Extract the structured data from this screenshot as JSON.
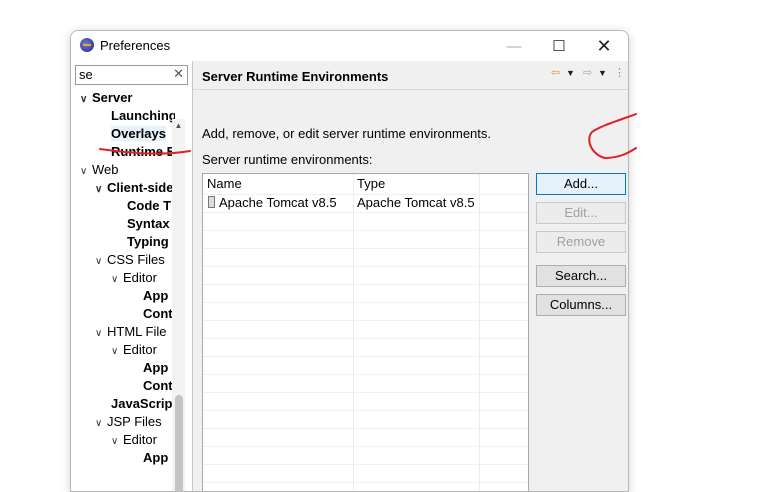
{
  "window": {
    "title": "Preferences",
    "minimize": "—",
    "maximize": "☐",
    "close": "✕"
  },
  "filter": {
    "value": "se",
    "clear": "✕"
  },
  "tree": [
    {
      "twisty": "∨",
      "label": "Server",
      "bold": true
    },
    {
      "twisty": "",
      "label": "Launching",
      "bold": true
    },
    {
      "twisty": "",
      "label": "Overlays",
      "bold": true,
      "selected": true
    },
    {
      "twisty": "",
      "label": "Runtime E",
      "bold": true
    },
    {
      "twisty": "∨",
      "label": "Web",
      "bold": false
    },
    {
      "twisty": "∨",
      "label": "Client-side",
      "bold": true
    },
    {
      "twisty": "",
      "label": "Code T",
      "bold": true
    },
    {
      "twisty": "",
      "label": "Syntax",
      "bold": true
    },
    {
      "twisty": "",
      "label": "Typing",
      "bold": true
    },
    {
      "twisty": "∨",
      "label": "CSS Files",
      "bold": false
    },
    {
      "twisty": "∨",
      "label": "Editor",
      "bold": false
    },
    {
      "twisty": "",
      "label": "App",
      "bold": true
    },
    {
      "twisty": "",
      "label": "Cont",
      "bold": true
    },
    {
      "twisty": "∨",
      "label": "HTML File",
      "bold": false
    },
    {
      "twisty": "∨",
      "label": "Editor",
      "bold": false
    },
    {
      "twisty": "",
      "label": "App",
      "bold": true
    },
    {
      "twisty": "",
      "label": "Cont",
      "bold": true
    },
    {
      "twisty": "",
      "label": "JavaScript",
      "bold": true
    },
    {
      "twisty": "∨",
      "label": "JSP Files",
      "bold": false
    },
    {
      "twisty": "∨",
      "label": "Editor",
      "bold": false
    },
    {
      "twisty": "",
      "label": "App",
      "bold": true
    }
  ],
  "page": {
    "title": "Server Runtime Environments",
    "description": "Add, remove, or edit server runtime environments.",
    "list_label": "Server runtime environments:"
  },
  "table": {
    "columns": [
      "Name",
      "Type"
    ],
    "rows": [
      {
        "name": "Apache Tomcat v8.5",
        "type": "Apache Tomcat v8.5"
      }
    ]
  },
  "buttons": {
    "add": "Add...",
    "edit": "Edit...",
    "remove": "Remove",
    "search": "Search...",
    "columns": "Columns..."
  },
  "colors": {
    "annotation_ink": "#e0202a",
    "selection": "#e5f1fb",
    "default_button": "#0078d7"
  }
}
